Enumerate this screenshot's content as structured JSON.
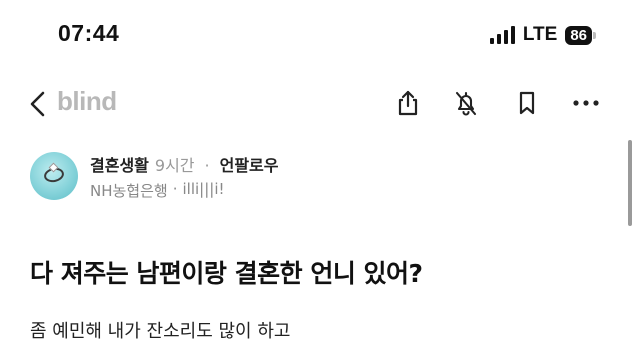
{
  "status_bar": {
    "time": "07:44",
    "network": "LTE",
    "battery": "86",
    "signal_icon": "signal-bars-icon"
  },
  "nav": {
    "brand": "blind",
    "back_icon": "chevron-left-icon",
    "actions": [
      "share-icon",
      "bell-off-icon",
      "bookmark-icon",
      "more-horizontal-icon"
    ]
  },
  "post": {
    "board": "결혼생활",
    "time_ago": "9시간",
    "separator": "·",
    "follow_label": "언팔로우",
    "company": "NH농협은행",
    "author": "illi|||i!",
    "title": "다 져주는 남편이랑 결혼한 언니 있어?",
    "body": "좀 예민해 내가 잔소리도 많이 하고"
  }
}
